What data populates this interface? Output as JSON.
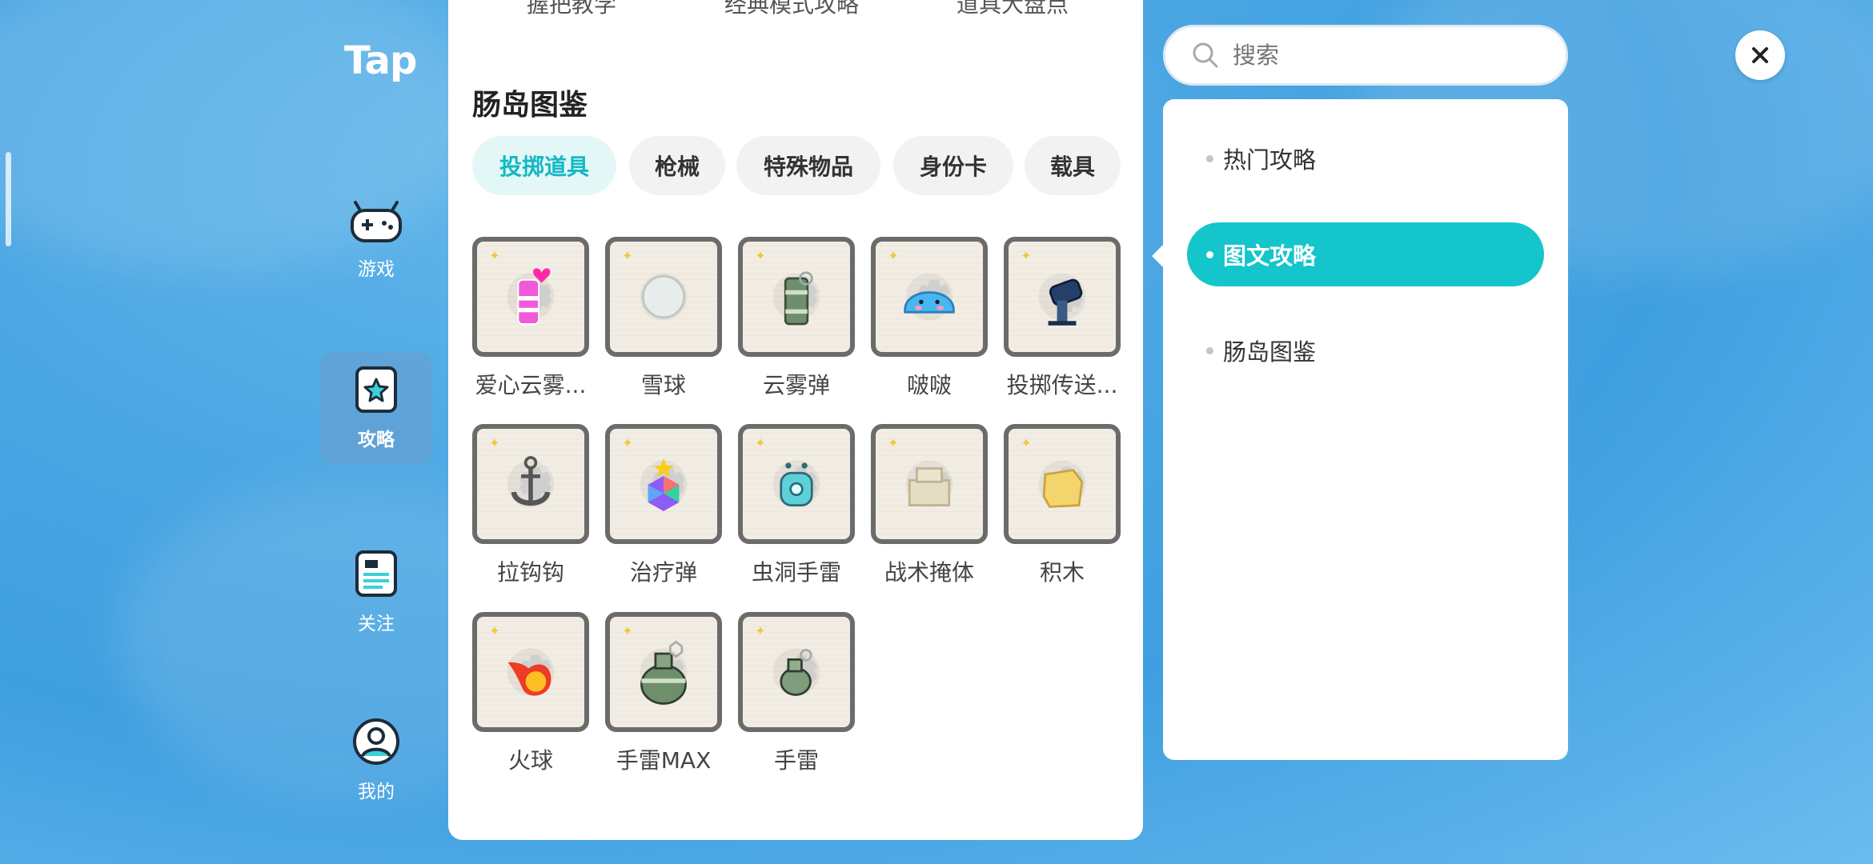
{
  "brand": "Tap",
  "nav": [
    {
      "label": "游戏",
      "icon": "gamepad-icon",
      "active": false
    },
    {
      "label": "攻略",
      "icon": "star-card-icon",
      "active": true
    },
    {
      "label": "关注",
      "icon": "list-card-icon",
      "active": false
    },
    {
      "label": "我的",
      "icon": "user-icon",
      "active": false
    }
  ],
  "top_links": [
    "握把教学",
    "经典模式攻略",
    "道具大盘点"
  ],
  "section_title": "肠岛图鉴",
  "tabs": [
    "投掷道具",
    "枪械",
    "特殊物品",
    "身份卡",
    "载具"
  ],
  "active_tab": "投掷道具",
  "items": [
    {
      "label": "爱心云雾...",
      "icon": "pink-love-smoke-icon"
    },
    {
      "label": "雪球",
      "icon": "snowball-icon"
    },
    {
      "label": "云雾弹",
      "icon": "smoke-grenade-icon"
    },
    {
      "label": "啵啵",
      "icon": "blue-slime-icon"
    },
    {
      "label": "投掷传送...",
      "icon": "teleport-cannon-icon"
    },
    {
      "label": "拉钩钩",
      "icon": "anchor-hook-icon"
    },
    {
      "label": "治疗弹",
      "icon": "healing-gem-icon"
    },
    {
      "label": "虫洞手雷",
      "icon": "wormhole-grenade-icon"
    },
    {
      "label": "战术掩体",
      "icon": "tactical-cover-icon"
    },
    {
      "label": "积木",
      "icon": "yellow-block-icon"
    },
    {
      "label": "火球",
      "icon": "fireball-icon"
    },
    {
      "label": "手雷MAX",
      "icon": "big-grenade-icon"
    },
    {
      "label": "手雷",
      "icon": "grenade-icon"
    }
  ],
  "search": {
    "placeholder": "搜索"
  },
  "menu": [
    {
      "label": "热门攻略",
      "active": false
    },
    {
      "label": "图文攻略",
      "active": true
    },
    {
      "label": "肠岛图鉴",
      "active": false
    }
  ],
  "colors": {
    "accent": "#14c5cc",
    "tab_active_text": "#14b8c4",
    "tab_active_bg": "#e3f7f7"
  }
}
